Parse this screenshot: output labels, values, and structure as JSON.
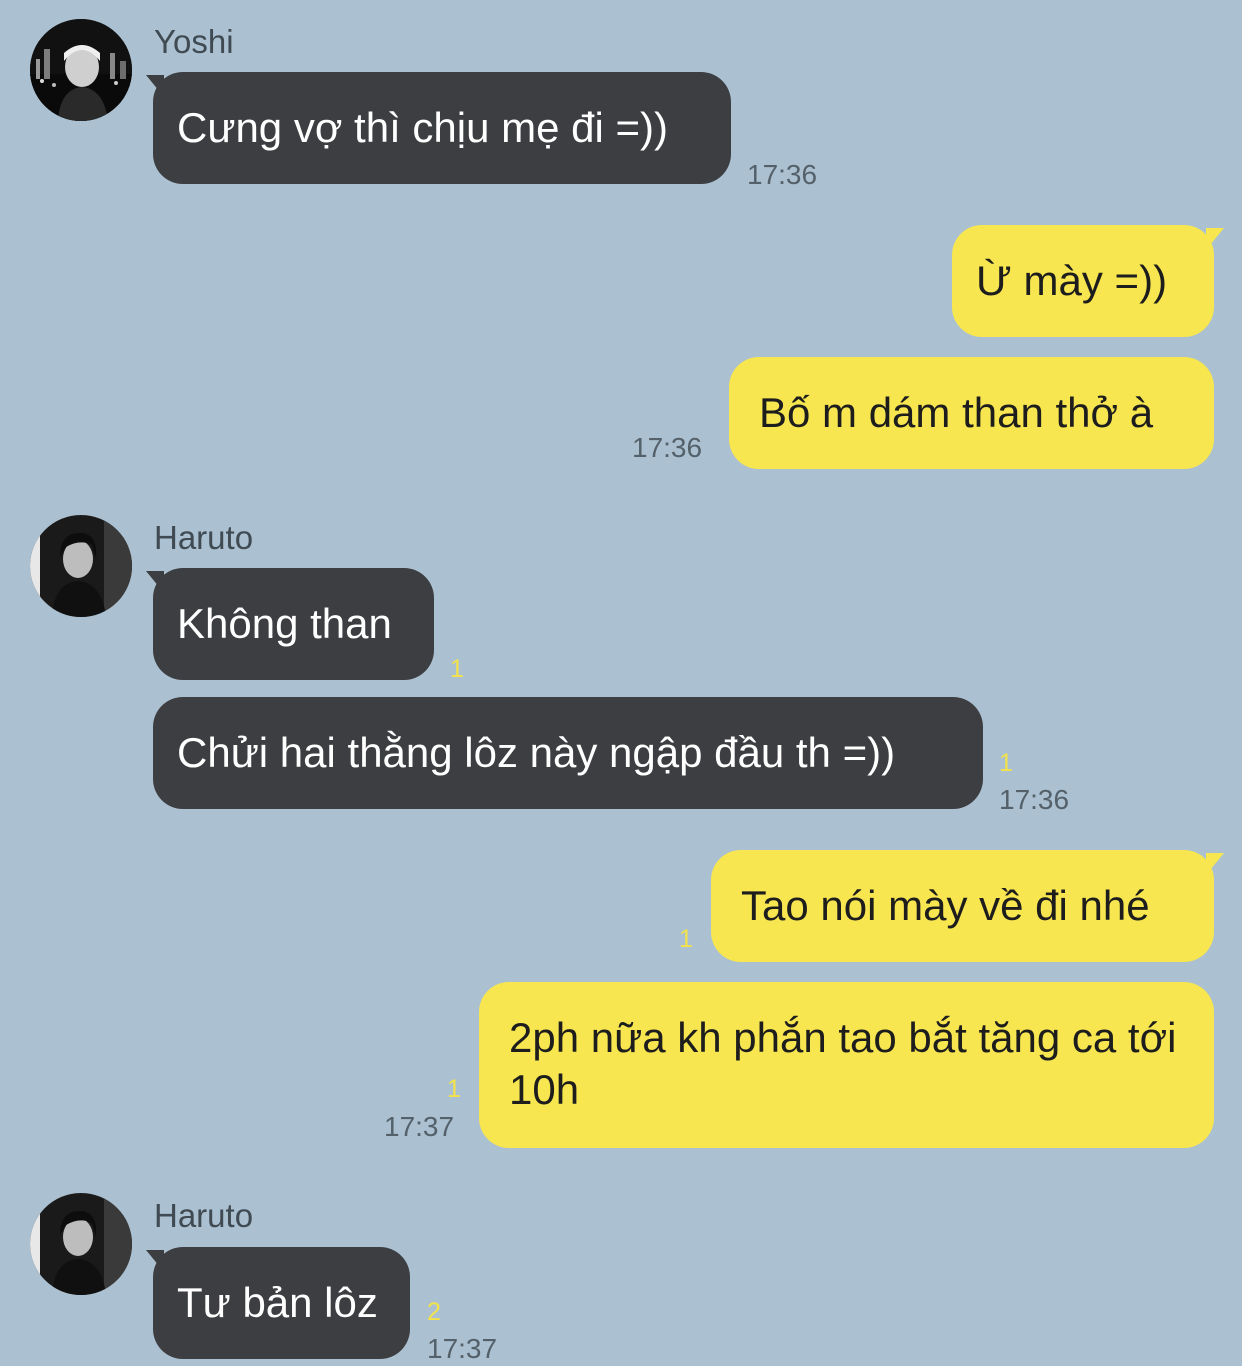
{
  "messages": [
    {
      "sender": "Yoshi",
      "direction": "in",
      "text": "Cưng vợ thì chịu mẹ đi =))",
      "time": "17:36"
    },
    {
      "direction": "out",
      "text": "Ừ mày =))"
    },
    {
      "direction": "out",
      "text": "Bố m dám than thở à",
      "time": "17:36"
    },
    {
      "sender": "Haruto",
      "direction": "in",
      "text": "Không than",
      "unread": "1"
    },
    {
      "direction": "in",
      "text": "Chửi hai thằng lôz này ngập đầu th =))",
      "unread": "1",
      "time": "17:36"
    },
    {
      "direction": "out",
      "text": "Tao nói mày về đi nhé",
      "unread": "1"
    },
    {
      "direction": "out",
      "text": "2ph nữa kh phắn tao bắt tăng ca tới 10h",
      "unread": "1",
      "time": "17:37"
    },
    {
      "sender": "Haruto",
      "direction": "in",
      "text": "Tư bản lôz",
      "unread": "2",
      "time": "17:37"
    }
  ],
  "colors": {
    "background": "#abc1d1",
    "incoming_bubble": "#3d3e42",
    "outgoing_bubble": "#f7e64f",
    "unread_count": "#f3e24a"
  },
  "avatars": {
    "yoshi": "yoshi-avatar",
    "haruto": "haruto-avatar"
  }
}
